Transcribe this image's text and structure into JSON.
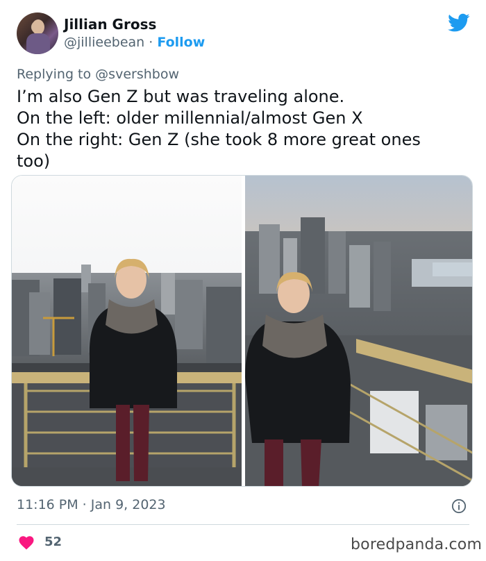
{
  "author": {
    "name": "Jillian Gross",
    "handle": "@jillieebean",
    "separator": "·",
    "follow_label": "Follow"
  },
  "reply": {
    "prefix": "Replying to",
    "mention": "@svershbow"
  },
  "tweet": {
    "lines": [
      "I’m also Gen Z but was traveling alone.",
      "On the left: older millennial/almost Gen X",
      "On the right: Gen Z (she took 8 more great ones",
      "too)"
    ]
  },
  "footer": {
    "timestamp": "11:16 PM · Jan 9, 2023",
    "likes": "52",
    "watermark": "boredpanda.com"
  },
  "icons": {
    "brand": "twitter-bird-icon",
    "info": "info-icon",
    "like": "heart-icon"
  },
  "colors": {
    "twitter_blue": "#1d9bf0",
    "secondary_text": "#536471",
    "like_red": "#f91880"
  }
}
